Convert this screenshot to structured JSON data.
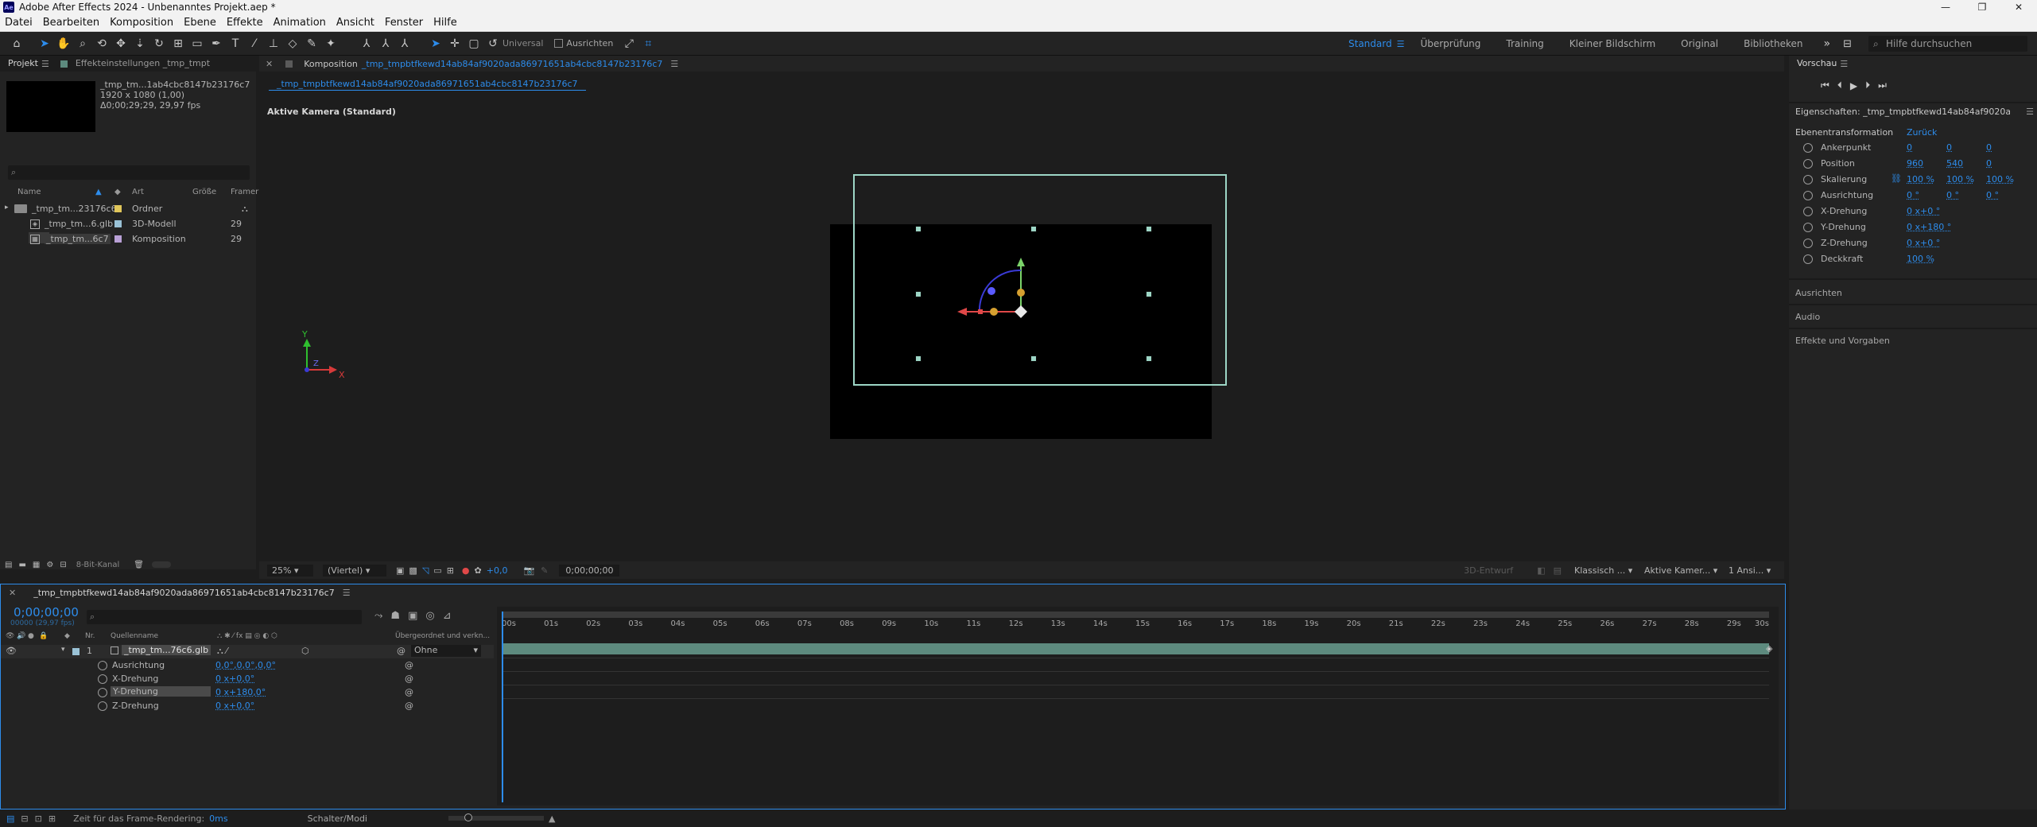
{
  "window": {
    "title": "Adobe After Effects 2024 - Unbenanntes Projekt.aep *",
    "logo": "Ae",
    "controls": [
      "—",
      "❐",
      "✕"
    ]
  },
  "menu": [
    "Datei",
    "Bearbeiten",
    "Komposition",
    "Ebene",
    "Effekte",
    "Animation",
    "Ansicht",
    "Fenster",
    "Hilfe"
  ],
  "toolbar": {
    "universal_label": "Universal",
    "align_label": "Ausrichten",
    "workspaces": [
      "Standard",
      "Überprüfung",
      "Training",
      "Kleiner Bildschirm",
      "Original",
      "Bibliotheken"
    ],
    "active_workspace": "Standard",
    "help_placeholder": "Hilfe durchsuchen"
  },
  "project": {
    "tab_project": "Projekt",
    "tab_effects": "Effekteinstellungen _tmp_tmpt",
    "preview_name": "_tmp_tm...1ab4cbc8147b23176c7",
    "preview_size": "1920 x 1080 (1,00)",
    "preview_duration": "Δ0;00;29;29, 29,97 fps",
    "columns": [
      "Name",
      "Art",
      "Größe",
      "Framer"
    ],
    "items": [
      {
        "name": "_tmp_tm...23176c6",
        "type": "Ordner",
        "size": "",
        "fps": "",
        "color": "#e0c65a"
      },
      {
        "name": "_tmp_tm...6.glb",
        "type": "3D-Modell",
        "size": "",
        "fps": "29",
        "color": "#9ac2d6"
      },
      {
        "name": "_tmp_tm...6c7",
        "type": "Komposition",
        "size": "",
        "fps": "29",
        "color": "#b9a0d6"
      }
    ],
    "bpc_label": "8-Bit-Kanal"
  },
  "comp": {
    "tab_prefix": "Komposition",
    "tab_name": "_tmp_tmpbtfkewd14ab84af9020ada86971651ab4cbc8147b23176c7",
    "subtab": "_tmp_tmpbtfkewd14ab84af9020ada86971651ab4cbc8147b23176c7",
    "camera_label": "Aktive Kamera (Standard)",
    "zoom": "25%",
    "resolution": "(Viertel)",
    "exposure": "+0,0",
    "timecode": "0;00;00;00",
    "renderer": "Klassisch ...",
    "camera_view": "Aktive Kamer...",
    "views": "1 Ansi...",
    "draft_label": "3D-Entwurf",
    "axis_y": "Y",
    "axis_x": "X",
    "axis_z": "Z"
  },
  "right": {
    "preview_title": "Vorschau",
    "properties_title": "Eigenschaften: _tmp_tmpbtfkewd14ab84af9020ada86971651ab4cbc8147b23176c7",
    "layer_transform": "Ebenentransformation",
    "reset": "Zurück",
    "props": [
      {
        "name": "Ankerpunkt",
        "v1": "0",
        "v2": "0",
        "v3": "0"
      },
      {
        "name": "Position",
        "v1": "960",
        "v2": "540",
        "v3": "0"
      },
      {
        "name": "Skalierung",
        "v1": "100 %",
        "v2": "100 %",
        "v3": "100 %"
      },
      {
        "name": "Ausrichtung",
        "v1": "0 °",
        "v2": "0 °",
        "v3": "0 °"
      },
      {
        "name": "X-Drehung",
        "v1": "0 x+0 °",
        "v2": "",
        "v3": ""
      },
      {
        "name": "Y-Drehung",
        "v1": "0 x+180 °",
        "v2": "",
        "v3": ""
      },
      {
        "name": "Z-Drehung",
        "v1": "0 x+0 °",
        "v2": "",
        "v3": ""
      },
      {
        "name": "Deckkraft",
        "v1": "100 %",
        "v2": "",
        "v3": ""
      }
    ],
    "sections": [
      "Ausrichten",
      "Audio",
      "Effekte und Vorgaben"
    ]
  },
  "timeline": {
    "tab_name": "_tmp_tmpbtfkewd14ab84af9020ada86971651ab4cbc8147b23176c7",
    "timecode": "0;00;00;00",
    "fps_info": "00000 (29,97 fps)",
    "col_nr": "Nr.",
    "col_source": "Quellenname",
    "col_parent": "Übergeordnet und verkn...",
    "layer": {
      "index": "1",
      "name": "_tmp_tm...76c6.glb",
      "parent": "Ohne"
    },
    "props": [
      {
        "name": "Ausrichtung",
        "value": "0,0°,0,0°,0,0°"
      },
      {
        "name": "X-Drehung",
        "value": "0 x+0,0°"
      },
      {
        "name": "Y-Drehung",
        "value": "0 x+180,0°"
      },
      {
        "name": "Z-Drehung",
        "value": "0 x+0,0°"
      }
    ],
    "ruler": [
      "00s",
      "01s",
      "02s",
      "03s",
      "04s",
      "05s",
      "06s",
      "07s",
      "08s",
      "09s",
      "10s",
      "11s",
      "12s",
      "13s",
      "14s",
      "15s",
      "16s",
      "17s",
      "18s",
      "19s",
      "20s",
      "21s",
      "22s",
      "23s",
      "24s",
      "25s",
      "26s",
      "27s",
      "28s",
      "29s",
      "30s"
    ]
  },
  "status": {
    "render_label": "Zeit für das Frame-Rendering:",
    "render_value": "0ms",
    "toggle_label": "Schalter/Modi"
  },
  "colors": {
    "accent": "#2d8ceb",
    "layer_bar": "#5d8a7e",
    "handle": "#9dd6c6"
  }
}
